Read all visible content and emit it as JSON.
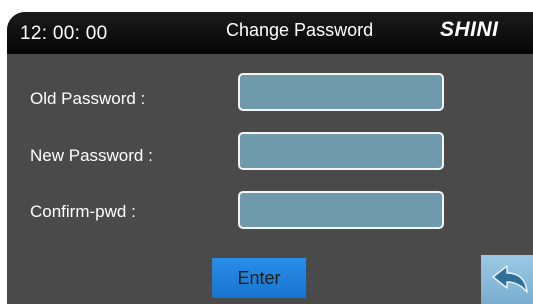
{
  "header": {
    "clock": "12: 00: 00",
    "title": "Change Password",
    "logo": "SHINI"
  },
  "form": {
    "fields": [
      {
        "label": "Old Password :",
        "value": ""
      },
      {
        "label": "New Password :",
        "value": ""
      },
      {
        "label": "Confirm-pwd :",
        "value": ""
      }
    ]
  },
  "actions": {
    "enter_label": "Enter",
    "back_icon": "back-arrow-icon"
  },
  "colors": {
    "panel": "#4a4a4a",
    "header": "#0d0d0d",
    "input_fill": "#6f9aab",
    "enter_button": "#1f82dc",
    "back_button": "#8fbfdf"
  }
}
